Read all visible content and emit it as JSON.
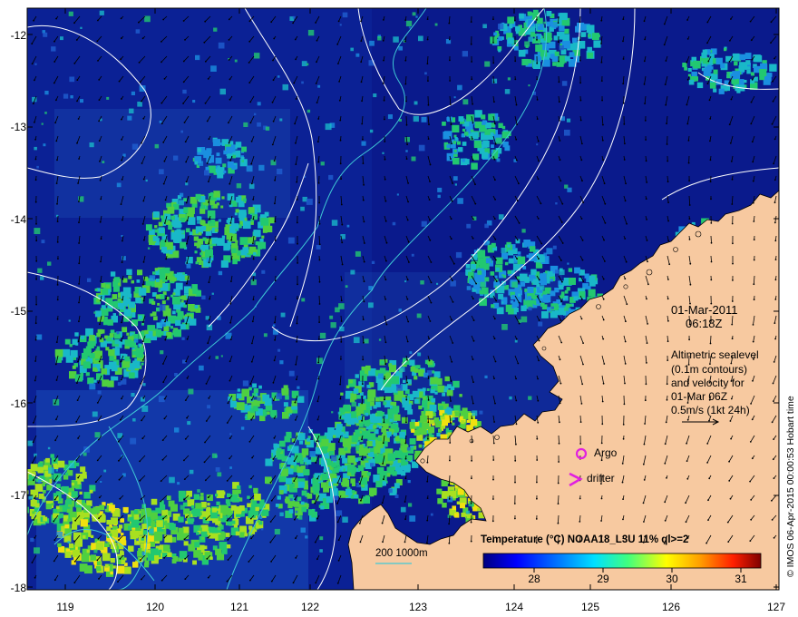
{
  "date_line1": "01-Mar-2011",
  "date_line2": "06:18Z",
  "altimetry_text": [
    "Altimetric sealevel",
    "(0.1m contours)",
    "and velocity for",
    "01-Mar 06Z",
    "0.5m/s (1kt 24h)"
  ],
  "legend": {
    "argo": "Argo",
    "drifter": "drifter"
  },
  "scale_bar_label": "200  1000m",
  "colorbar": {
    "title": "Temperature (°C) NOAA18_L3U 11% ql>=2",
    "ticks": [
      "28",
      "29",
      "30",
      "31"
    ],
    "colors": [
      "#00007f",
      "#0000ff",
      "#007fff",
      "#00ffff",
      "#7fff7f",
      "#ffff00",
      "#ff7f00",
      "#ff0000",
      "#7f0000"
    ]
  },
  "credit": "© IMOS 06-Apr-2015 00:00:53 Hobart time",
  "axes": {
    "lat_ticks": [
      "-12",
      "-13",
      "-14",
      "-15",
      "-16",
      "-17",
      "-18"
    ],
    "lon_ticks": [
      "119",
      "120",
      "121",
      "122",
      "123",
      "124",
      "125",
      "126",
      "127"
    ]
  },
  "colors": {
    "ocean": "#0a1a8c",
    "land": "#f7c9a0",
    "contour": "#ffffff",
    "bathymetry": "#3fc9d6",
    "marker": "#e020e0"
  }
}
